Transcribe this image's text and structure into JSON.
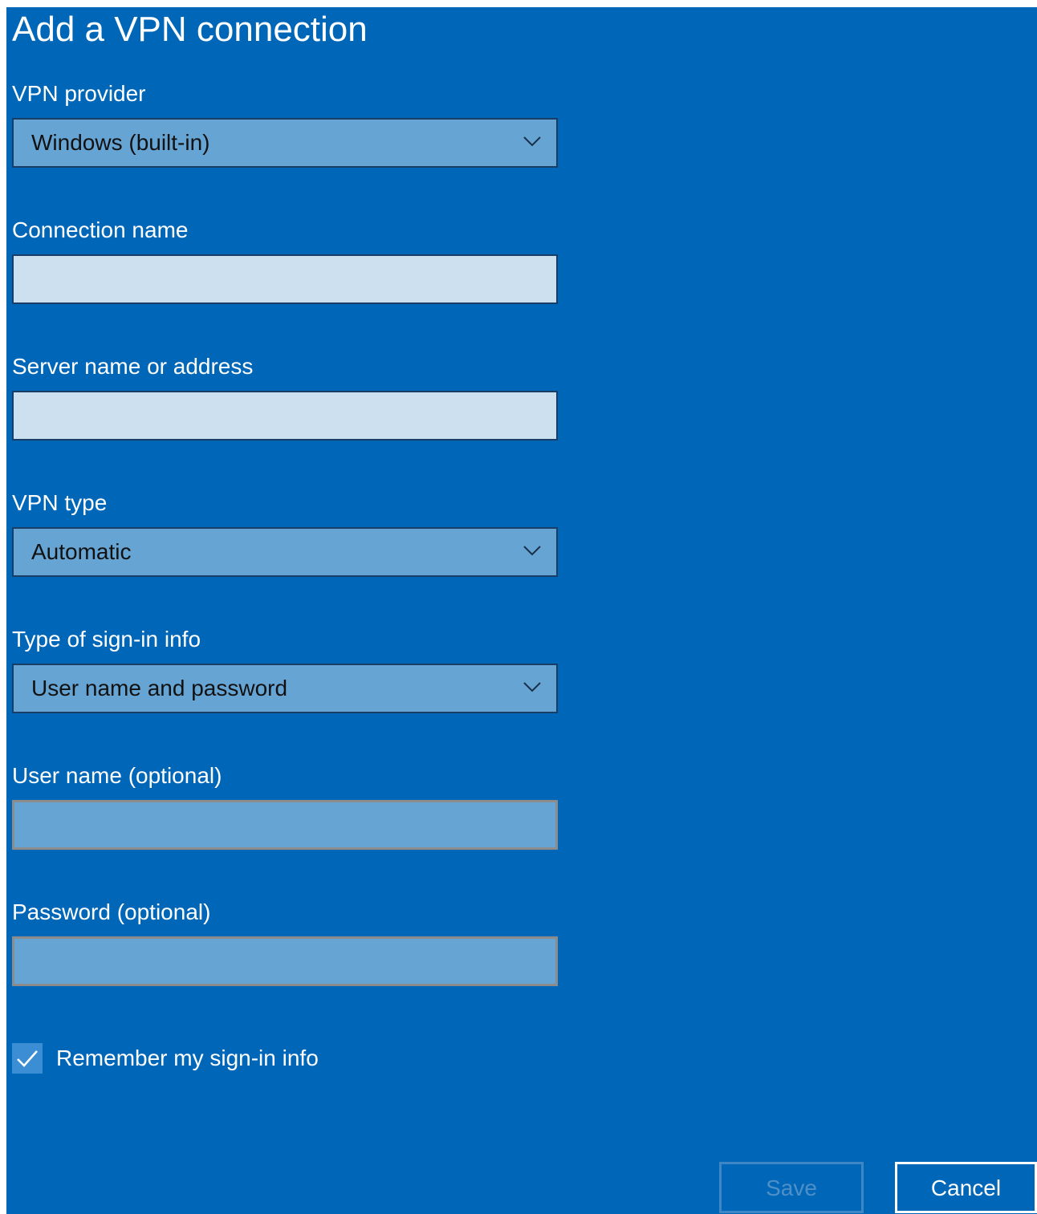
{
  "dialog": {
    "title": "Add a VPN connection",
    "background_color": "#0067b8"
  },
  "fields": {
    "vpn_provider": {
      "label": "VPN provider",
      "value": "Windows (built-in)"
    },
    "connection_name": {
      "label": "Connection name",
      "value": ""
    },
    "server_name": {
      "label": "Server name or address",
      "value": ""
    },
    "vpn_type": {
      "label": "VPN type",
      "value": "Automatic"
    },
    "sign_in_type": {
      "label": "Type of sign-in info",
      "value": "User name and password"
    },
    "user_name": {
      "label": "User name (optional)",
      "value": ""
    },
    "password": {
      "label": "Password (optional)",
      "value": ""
    }
  },
  "remember": {
    "label": "Remember my sign-in info",
    "checked": true
  },
  "buttons": {
    "save_label": "Save",
    "save_enabled": false,
    "cancel_label": "Cancel"
  },
  "icons": {
    "dropdown": "chevron-down-icon",
    "checkbox": "checkmark-icon"
  }
}
